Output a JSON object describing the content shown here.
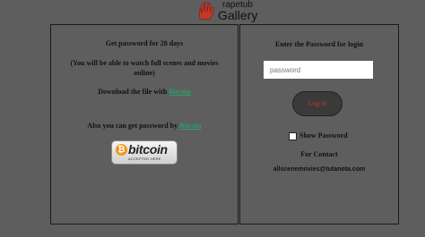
{
  "header": {
    "logo_top": "rapetub",
    "logo_bottom": "Gallery"
  },
  "left_panel": {
    "title": "Get password for 28 days",
    "desc_line1": "(You will be able to watch full scenes and movies",
    "desc_line2": "online)",
    "download_text": "Download the file with",
    "download_link": "Bitcoin",
    "also_text": "Also you can get password by",
    "also_link": "Bitcoin",
    "badge_word": "bitcoin",
    "badge_sub": "ACCEPTED HERE"
  },
  "right_panel": {
    "title": "Enter the Password for login",
    "password_placeholder": "password",
    "password_value": "",
    "login_label": "Log in",
    "show_password_label": "Show Password",
    "show_password_checked": false,
    "contact_title": "For Contact",
    "contact_email": "allscenemovies@tutanota.com"
  },
  "colors": {
    "background": "#5e5e5e",
    "link": "#2a9d6a",
    "login_text": "#c0392b",
    "logo_hand": "#c0392b",
    "bitcoin_orange": "#f7931a"
  }
}
